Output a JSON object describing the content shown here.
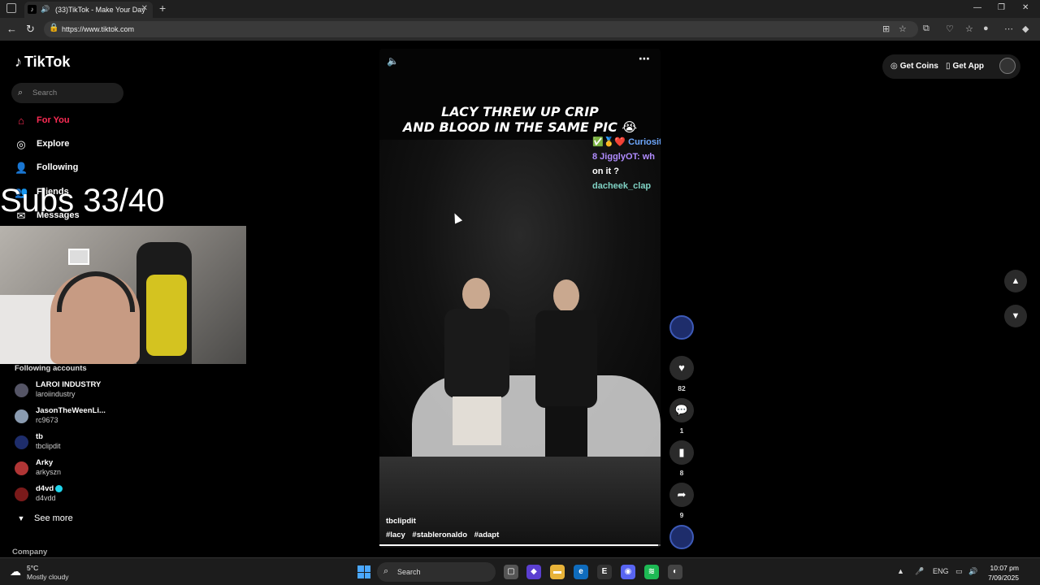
{
  "browser": {
    "tab_title": "(33)TikTok - Make Your Day",
    "url": "https://www.tiktok.com",
    "favicon": "tiktok-icon"
  },
  "sidebar": {
    "logo": "TikTok",
    "search_placeholder": "Search",
    "nav": [
      {
        "label": "For You",
        "icon": "home-icon"
      },
      {
        "label": "Explore",
        "icon": "compass-icon"
      },
      {
        "label": "Following",
        "icon": "following-icon"
      },
      {
        "label": "Friends",
        "icon": "friends-icon"
      },
      {
        "label": "Messages",
        "icon": "messages-icon"
      }
    ],
    "following_title": "Following accounts",
    "accounts": [
      {
        "name": "LAROI INDUSTRY",
        "handle": "laroiindustry"
      },
      {
        "name": "JasonTheWeenLi...",
        "handle": "rc9673"
      },
      {
        "name": "tb",
        "handle": "tbclipdit"
      },
      {
        "name": "Arky",
        "handle": "arkyszn"
      },
      {
        "name": "d4vd",
        "handle": "d4vdd"
      }
    ],
    "see_more": "See more",
    "company": "Company"
  },
  "overlay": {
    "subs_text": "Subs 33/40"
  },
  "video": {
    "caption_line1": "LACY THREW UP CRIP",
    "caption_line2": "AND BLOOD IN THE SAME PIC 😭",
    "chat": [
      "✅🥇❤️ Curiosity",
      "8 JigglyOT: wh",
      "on it ?",
      "dacheek_clap"
    ],
    "author": "tbclipdit",
    "tags": [
      "#lacy",
      "#stableronaldo",
      "#adapt"
    ],
    "progress_fraction": 0.99
  },
  "actions": {
    "likes": "82",
    "comments": "1",
    "saves": "8",
    "shares": "9"
  },
  "topbar": {
    "get_coins": "Get Coins",
    "get_app": "Get App"
  },
  "taskbar": {
    "weather_temp": "5°C",
    "weather_desc": "Mostly cloudy",
    "search": "Search",
    "lang": "ENG",
    "time": "10:07 pm",
    "date": "7/09/2025"
  },
  "colors": {
    "accent": "#fe2c55",
    "background": "#000000"
  }
}
